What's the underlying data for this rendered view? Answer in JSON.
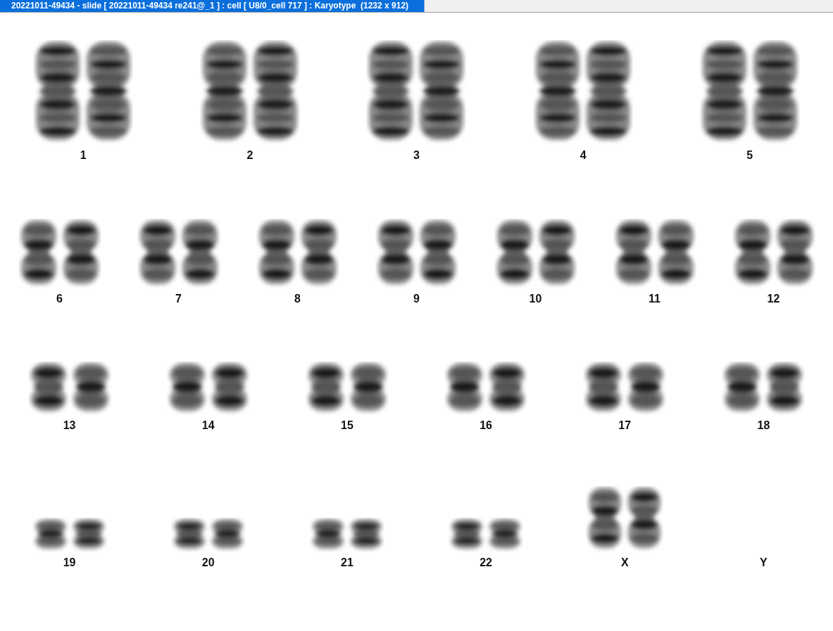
{
  "window": {
    "title": "20221011-49434 - slide [ 20221011-49434 re241@_1 ] : cell [ U8/0_cell 717 ] : Karyotype  (1232 x 912)"
  },
  "rows": [
    [
      {
        "label": "1",
        "kind": "autosome",
        "present": true
      },
      {
        "label": "2",
        "kind": "autosome",
        "present": true
      },
      {
        "label": "3",
        "kind": "autosome",
        "present": true
      },
      {
        "label": "4",
        "kind": "autosome",
        "present": true
      },
      {
        "label": "5",
        "kind": "autosome",
        "present": true
      }
    ],
    [
      {
        "label": "6",
        "kind": "autosome",
        "present": true
      },
      {
        "label": "7",
        "kind": "autosome",
        "present": true
      },
      {
        "label": "8",
        "kind": "autosome",
        "present": true
      },
      {
        "label": "9",
        "kind": "autosome",
        "present": true
      },
      {
        "label": "10",
        "kind": "autosome",
        "present": true
      },
      {
        "label": "11",
        "kind": "autosome",
        "present": true
      },
      {
        "label": "12",
        "kind": "autosome",
        "present": true
      }
    ],
    [
      {
        "label": "13",
        "kind": "autosome",
        "present": true
      },
      {
        "label": "14",
        "kind": "autosome",
        "present": true
      },
      {
        "label": "15",
        "kind": "autosome",
        "present": true
      },
      {
        "label": "16",
        "kind": "autosome",
        "present": true
      },
      {
        "label": "17",
        "kind": "autosome",
        "present": true
      },
      {
        "label": "18",
        "kind": "autosome",
        "present": true
      }
    ],
    [
      {
        "label": "19",
        "kind": "autosome",
        "present": true
      },
      {
        "label": "20",
        "kind": "autosome",
        "present": true
      },
      {
        "label": "21",
        "kind": "autosome",
        "present": true
      },
      {
        "label": "22",
        "kind": "autosome",
        "present": true
      },
      {
        "label": "X",
        "kind": "sex",
        "present": true
      },
      {
        "label": "Y",
        "kind": "sex",
        "present": false
      }
    ]
  ]
}
